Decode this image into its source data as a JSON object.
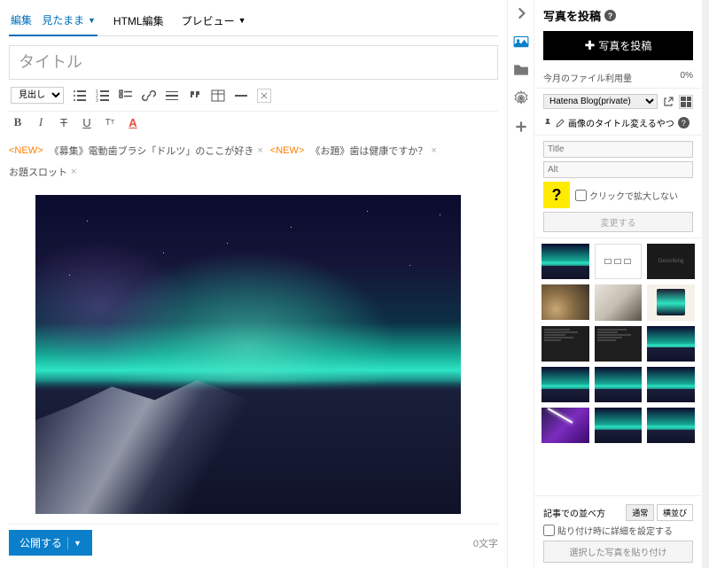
{
  "tabs": {
    "edit_prefix": "編集",
    "edit": "見たまま",
    "html": "HTML編集",
    "preview": "プレビュー"
  },
  "title_placeholder": "タイトル",
  "heading": "見出し",
  "suggest": {
    "new": "<NEW>",
    "item1": "《募集》電動歯ブラシ「ドルツ」のここが好き",
    "item2": "《お題》歯は健康ですか？",
    "slot": "お題スロット"
  },
  "footer": {
    "publish": "公開する",
    "chars": "0文字"
  },
  "panel": {
    "title": "写真を投稿",
    "upload": "写真を投稿",
    "usage": "今月のファイル利用量",
    "usage_pct": "0%",
    "blog": "Hatena Blog(private)",
    "titlechg": "画像のタイトル変えるやつ",
    "title_ph": "Title",
    "alt_ph": "Alt",
    "noexpand": "クリックで拡大しない",
    "change": "変更する",
    "darktext": "Describing",
    "arrange": "記事での並べ方",
    "normal": "通常",
    "horiz": "横並び",
    "detail": "貼り付け時に詳細を設定する",
    "paste": "選択した写真を貼り付け"
  }
}
